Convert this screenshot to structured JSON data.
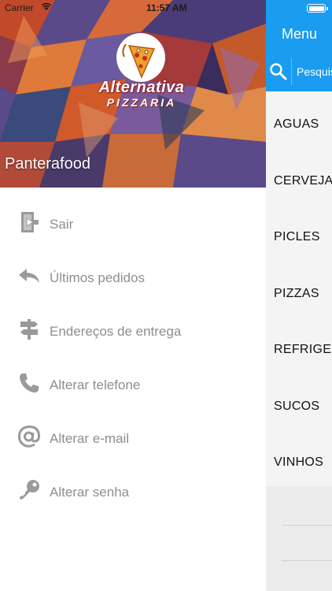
{
  "status_bar": {
    "carrier": "Carrier",
    "time": "11:57 AM"
  },
  "drawer": {
    "logo": {
      "line1": "Alternativa",
      "line2": "PIZZARIA"
    },
    "username": "Panterafood",
    "items": [
      {
        "label": "Sair",
        "icon": "exit-door-icon"
      },
      {
        "label": "Últimos pedidos",
        "icon": "reply-arrow-icon"
      },
      {
        "label": "Endereços de entrega",
        "icon": "signpost-icon"
      },
      {
        "label": "Alterar telefone",
        "icon": "phone-icon"
      },
      {
        "label": "Alterar e-mail",
        "icon": "at-sign-icon"
      },
      {
        "label": "Alterar senha",
        "icon": "key-icon"
      }
    ]
  },
  "main": {
    "title": "Menu",
    "search_placeholder": "Pesquisar",
    "categories": [
      "AGUAS",
      "CERVEJAS",
      "PICLES",
      "PIZZAS",
      "REFRIGERANTES",
      "SUCOS",
      "VINHOS"
    ]
  },
  "colors": {
    "accent": "#1a9cf0",
    "menu_text": "#8e8e8e",
    "icon": "#9a9a9a"
  }
}
